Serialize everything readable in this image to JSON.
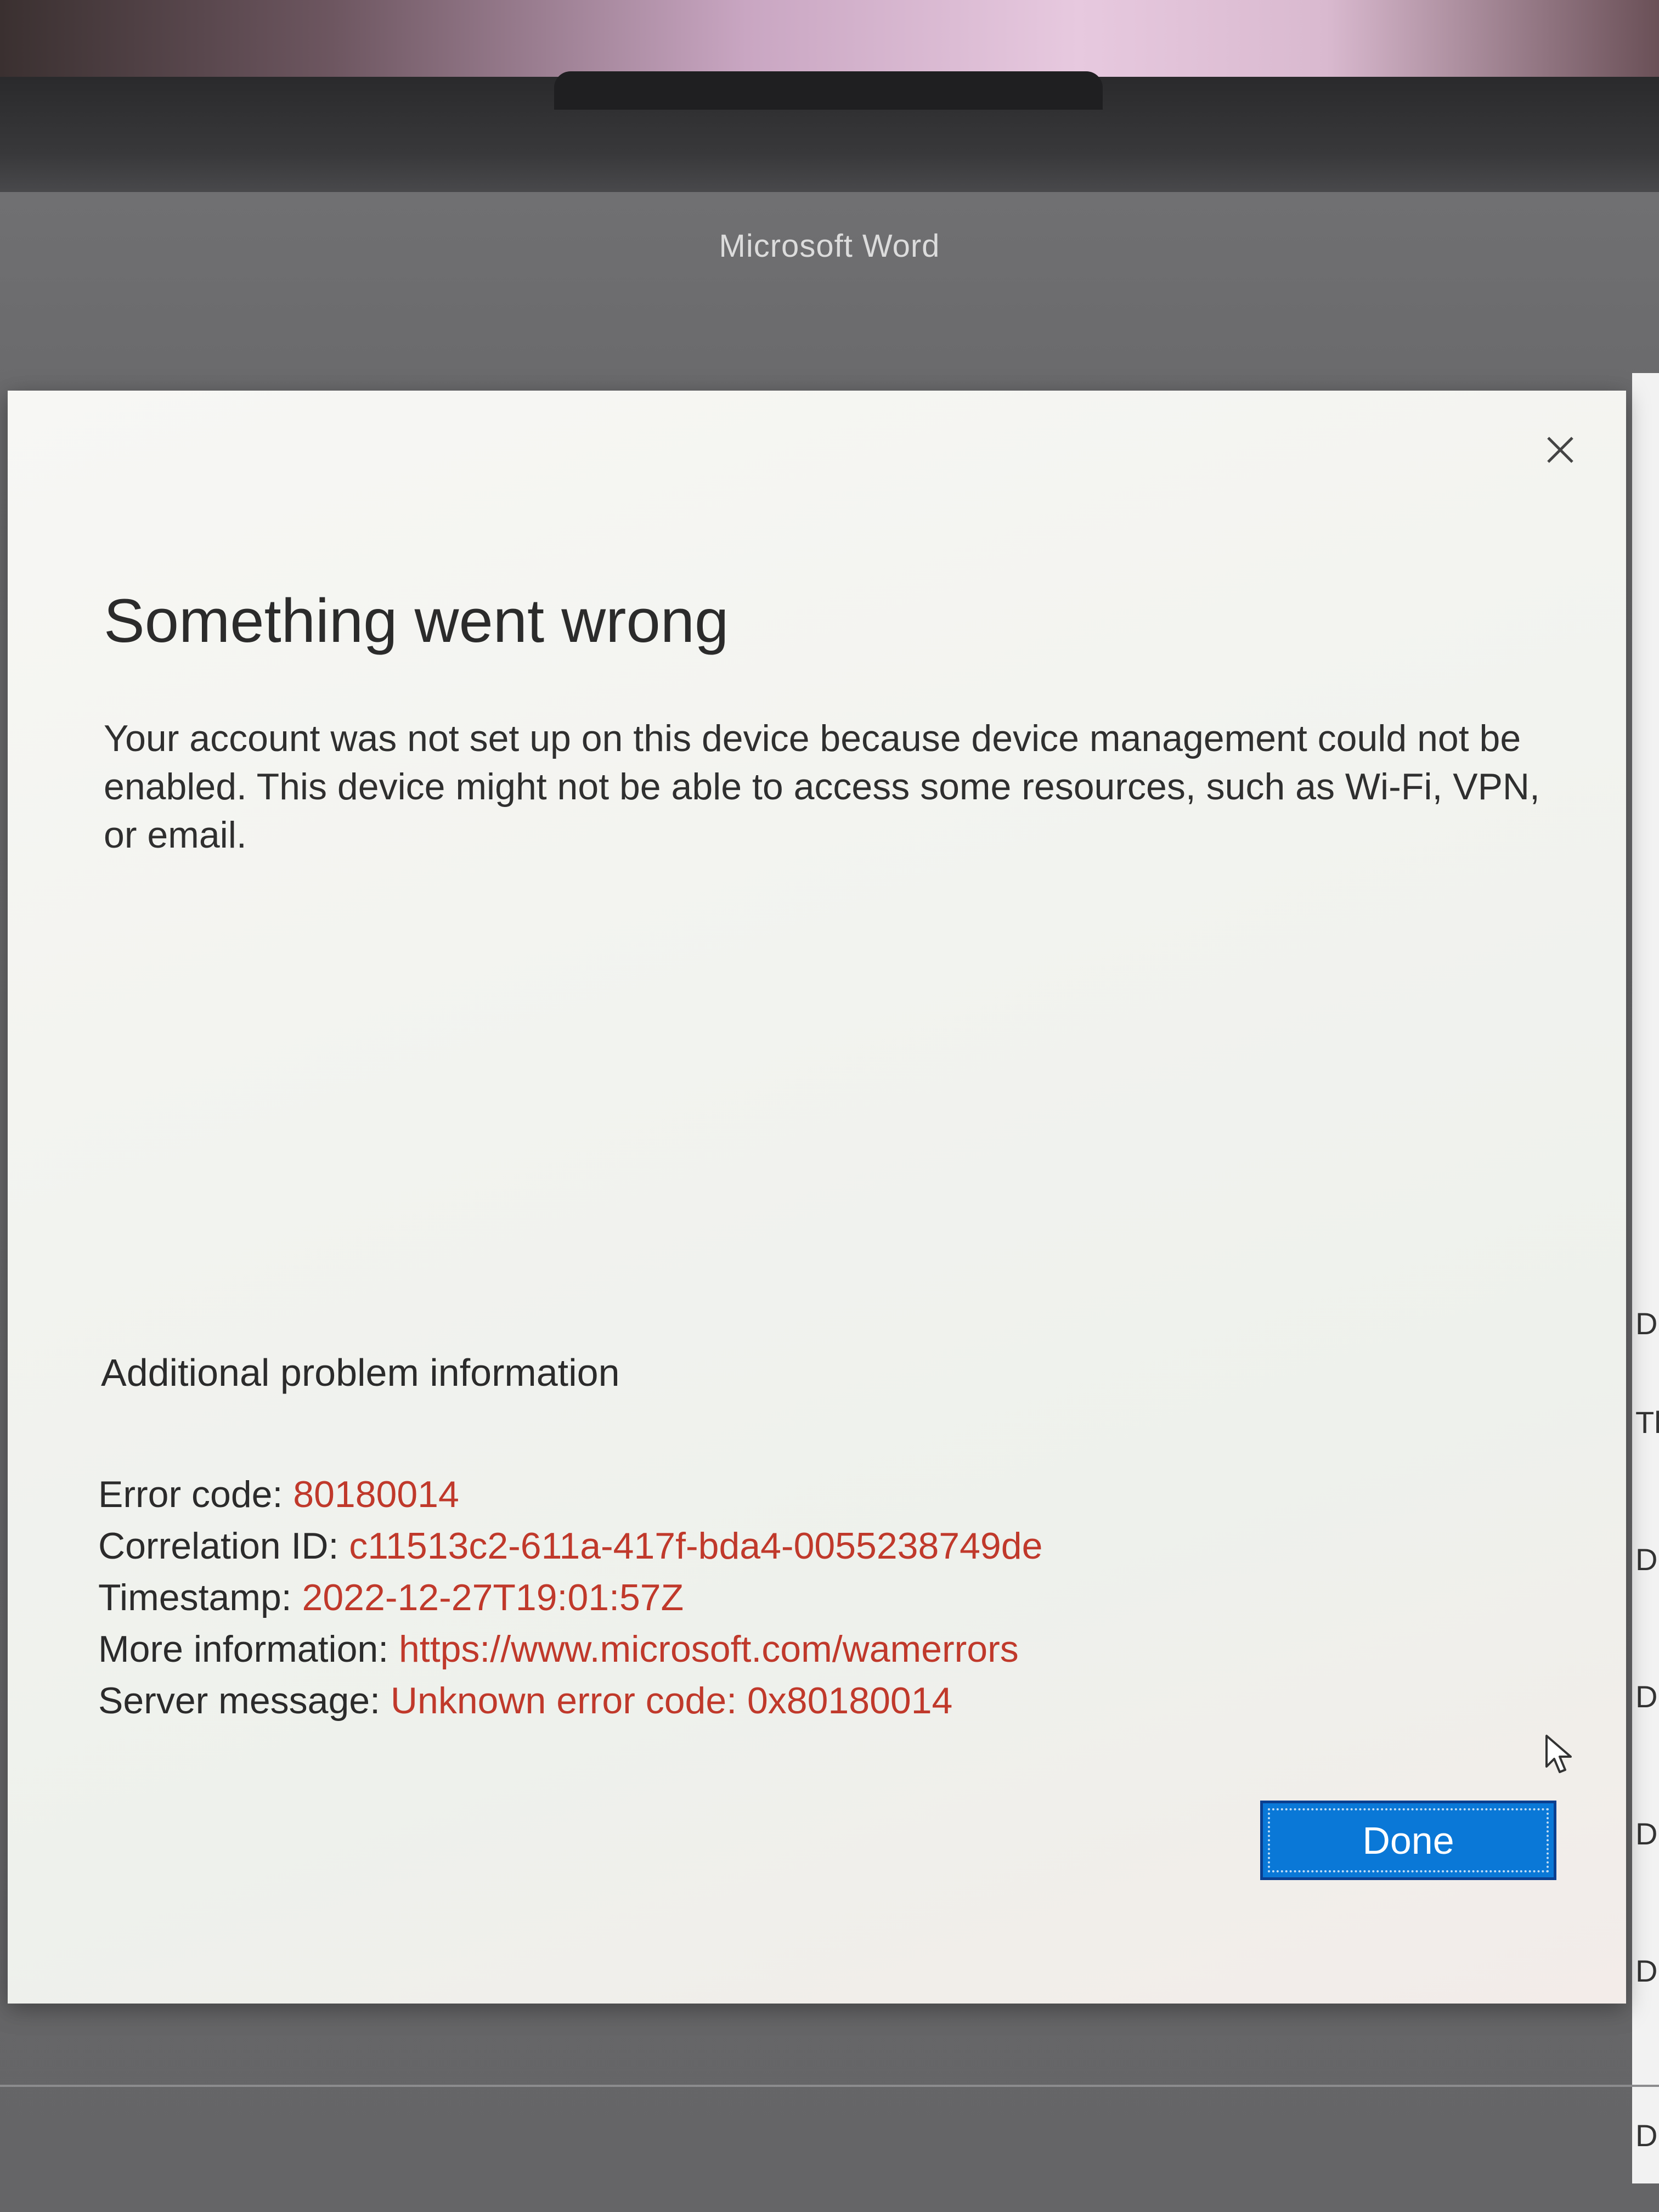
{
  "window": {
    "app_title": "Microsoft Word"
  },
  "dialog": {
    "title": "Something went wrong",
    "message": "Your account was not set up on this device because device management could not be enabled. This device might not be able to access some resources, such as Wi-Fi, VPN, or email.",
    "close_icon": "close-icon",
    "additional_info_heading": "Additional problem information",
    "details": [
      {
        "label": "Error code: ",
        "value": "80180014"
      },
      {
        "label": "Correlation ID: ",
        "value": "c11513c2-611a-417f-bda4-0055238749de"
      },
      {
        "label": "Timestamp: ",
        "value": "2022-12-27T19:01:57Z"
      },
      {
        "label": "More information: ",
        "value": "https://www.microsoft.com/wamerrors"
      },
      {
        "label": "Server message: ",
        "value": "Unknown error code: 0x80180014"
      }
    ],
    "done_label": "Done"
  },
  "background_partial_text": [
    "Da",
    "Th",
    "D",
    "D",
    "D",
    "D",
    "D"
  ],
  "colors": {
    "accent": "#0a78d7",
    "error_value": "#c0392b",
    "dialog_bg": "#f5f5f2"
  }
}
